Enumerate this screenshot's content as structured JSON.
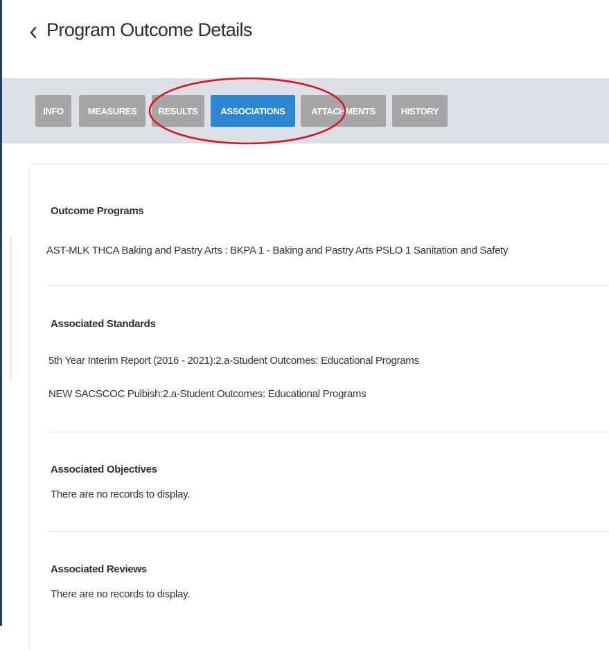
{
  "header": {
    "back_icon": "chevron-left-icon",
    "title": "Program Outcome Details"
  },
  "tabs": [
    {
      "label": "INFO",
      "active": false
    },
    {
      "label": "MEASURES",
      "active": false
    },
    {
      "label": "RESULTS",
      "active": false
    },
    {
      "label": "ASSOCIATIONS",
      "active": true
    },
    {
      "label": "ATTACHMENTS",
      "active": false
    },
    {
      "label": "HISTORY",
      "active": false
    }
  ],
  "colors": {
    "tab_default": "#a6a6a8",
    "tab_active": "#2d86d1",
    "tab_bar_bg": "#dde0e6",
    "annotation": "#d9151e"
  },
  "sections": {
    "outcome_programs": {
      "title": "Outcome Programs",
      "items": [
        "AST-MLK THCA Baking and Pastry Arts : BKPA 1 - Baking and Pastry Arts PSLO 1 Sanitation and Safety"
      ]
    },
    "associated_standards": {
      "title": "Associated Standards",
      "items": [
        "5th Year Interim Report (2016 - 2021):2.a-Student Outcomes: Educational Programs",
        "NEW SACSCOC Pulbish:2.a-Student Outcomes: Educational Programs"
      ]
    },
    "associated_objectives": {
      "title": "Associated Objectives",
      "empty_text": "There are no records to display."
    },
    "associated_reviews": {
      "title": "Associated Reviews",
      "empty_text": "There are no records to display."
    }
  }
}
